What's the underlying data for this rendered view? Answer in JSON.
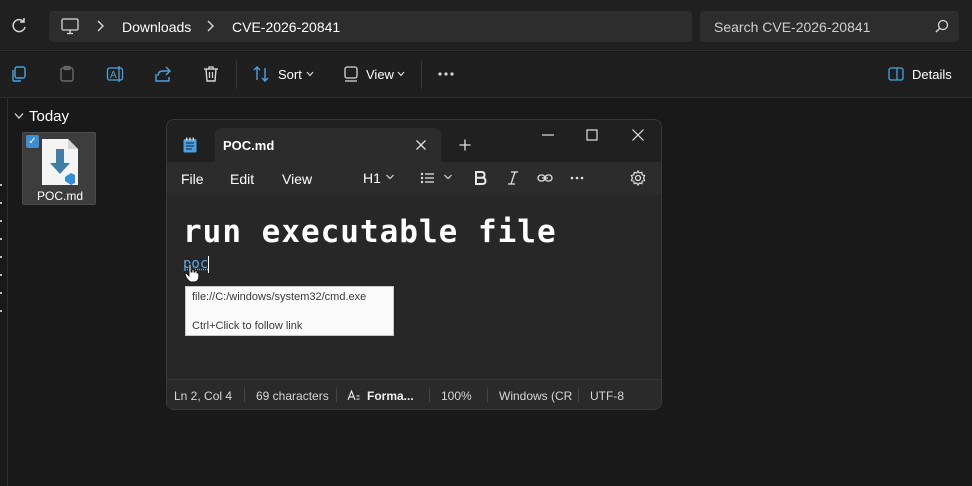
{
  "address_bar": {
    "breadcrumbs": [
      "Downloads",
      "CVE-2026-20841"
    ],
    "search_placeholder": "Search CVE-2026-20841"
  },
  "toolbar": {
    "sort_label": "Sort",
    "view_label": "View",
    "details_label": "Details"
  },
  "content": {
    "group_label": "Today",
    "files": [
      {
        "name": "POC.md",
        "selected": true
      }
    ]
  },
  "notepad": {
    "tab_title": "POC.md",
    "menu": [
      "File",
      "Edit",
      "View"
    ],
    "heading_style": "H1",
    "heading_text": "run executable file",
    "link_text": "poc",
    "tooltip": {
      "url": "file://C:/windows/system32/cmd.exe",
      "hint": "Ctrl+Click to follow link"
    },
    "status": {
      "position": "Ln 2, Col 4",
      "characters": "69 characters",
      "formatting": "Forma...",
      "zoom": "100%",
      "line_ending": "Windows (CR",
      "encoding": "UTF-8"
    }
  },
  "colors": {
    "accent": "#3b8fd9",
    "link": "#5aa9e6"
  }
}
